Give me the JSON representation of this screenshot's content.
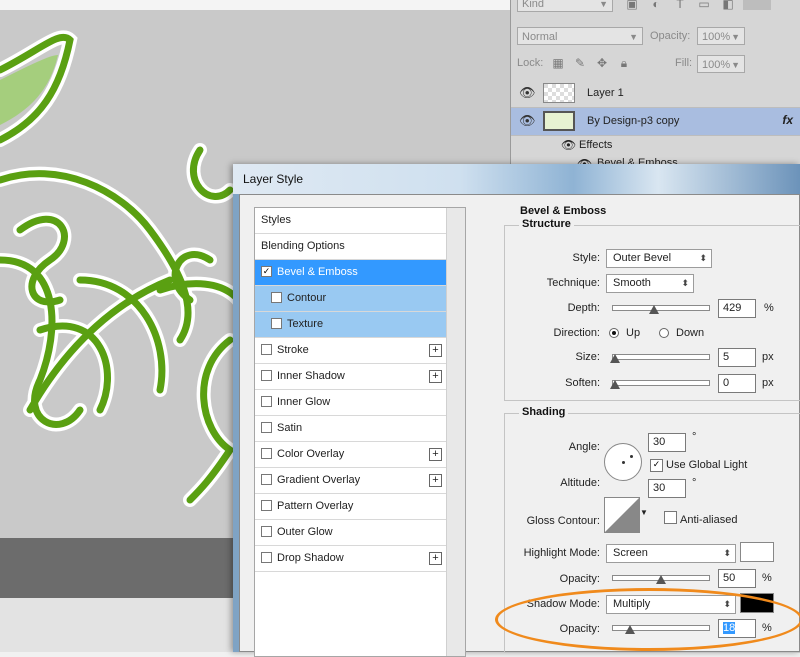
{
  "layers_panel": {
    "filter_kind": "Kind",
    "blend_mode": "Normal",
    "opacity_label": "Opacity:",
    "opacity_value": "100%",
    "lock_label": "Lock:",
    "fill_label": "Fill:",
    "fill_value": "100%",
    "layers": [
      {
        "name": "Layer 1",
        "selected": false
      },
      {
        "name": "By Design-p3 copy",
        "selected": true,
        "fx": "fx"
      }
    ],
    "effects_label": "Effects",
    "effect_bevel": "Bevel & Emboss"
  },
  "dialog": {
    "title": "Layer Style",
    "styles_list": [
      {
        "label": "Styles",
        "type": "header"
      },
      {
        "label": "Blending Options",
        "type": "header"
      },
      {
        "label": "Bevel & Emboss",
        "checked": true,
        "selected": true
      },
      {
        "label": "Contour",
        "checked": false,
        "sub": true
      },
      {
        "label": "Texture",
        "checked": false,
        "sub": true
      },
      {
        "label": "Stroke",
        "checked": false,
        "plus": true
      },
      {
        "label": "Inner Shadow",
        "checked": false,
        "plus": true
      },
      {
        "label": "Inner Glow",
        "checked": false
      },
      {
        "label": "Satin",
        "checked": false
      },
      {
        "label": "Color Overlay",
        "checked": false,
        "plus": true
      },
      {
        "label": "Gradient Overlay",
        "checked": false,
        "plus": true
      },
      {
        "label": "Pattern Overlay",
        "checked": false
      },
      {
        "label": "Outer Glow",
        "checked": false
      },
      {
        "label": "Drop Shadow",
        "checked": false,
        "plus": true
      }
    ],
    "panel_title": "Bevel & Emboss",
    "structure": {
      "title": "Structure",
      "style_label": "Style:",
      "style_value": "Outer Bevel",
      "technique_label": "Technique:",
      "technique_value": "Smooth",
      "depth_label": "Depth:",
      "depth_value": "429",
      "depth_unit": "%",
      "direction_label": "Direction:",
      "direction_up": "Up",
      "direction_down": "Down",
      "size_label": "Size:",
      "size_value": "5",
      "size_unit": "px",
      "soften_label": "Soften:",
      "soften_value": "0",
      "soften_unit": "px"
    },
    "shading": {
      "title": "Shading",
      "angle_label": "Angle:",
      "angle_value": "30",
      "degree": "°",
      "use_global_light": "Use Global Light",
      "altitude_label": "Altitude:",
      "altitude_value": "30",
      "gloss_contour_label": "Gloss Contour:",
      "anti_aliased": "Anti-aliased",
      "highlight_mode_label": "Highlight Mode:",
      "highlight_mode_value": "Screen",
      "highlight_color": "#ffffff",
      "highlight_opacity_label": "Opacity:",
      "highlight_opacity_value": "50",
      "shadow_mode_label": "Shadow Mode:",
      "shadow_mode_value": "Multiply",
      "shadow_color": "#000000",
      "shadow_opacity_label": "Opacity:",
      "shadow_opacity_value": "18",
      "percent": "%"
    }
  },
  "colors": {
    "selection_blue": "#3399ff",
    "annotation_orange": "#f08a1c",
    "vine_green": "#5aa012"
  }
}
